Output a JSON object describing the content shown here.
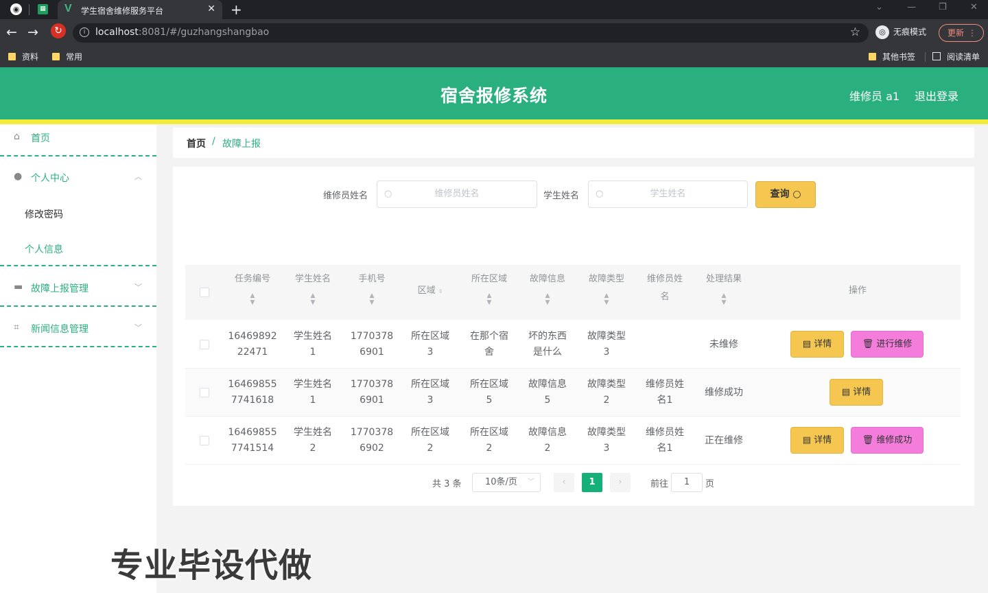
{
  "browser": {
    "tab_title": "学生宿舍维修服务平台",
    "url_host": "localhost",
    "url_rest": ":8081/#/guzhangshangbao",
    "incognito_label": "无痕模式",
    "update_label": "更新",
    "bookmarks": [
      "资料",
      "常用"
    ],
    "bookmarks_right": [
      "其他书签",
      "阅读清单"
    ]
  },
  "header": {
    "title": "宿舍报修系统",
    "user_label": "维修员 a1",
    "logout_label": "退出登录"
  },
  "sidebar": {
    "home": "首页",
    "personal_center": "个人中心",
    "change_password": "修改密码",
    "personal_info": "个人信息",
    "fault_report_mgmt": "故障上报管理",
    "news_mgmt": "新闻信息管理"
  },
  "breadcrumb": {
    "home": "首页",
    "separator": "/",
    "current": "故障上报"
  },
  "search": {
    "repairer_label": "维修员姓名",
    "repairer_placeholder": "维修员姓名",
    "student_label": "学生姓名",
    "student_placeholder": "学生姓名",
    "query_label": "查询"
  },
  "table": {
    "columns": [
      "任务编号",
      "学生姓名",
      "手机号",
      "区域",
      "所在区域",
      "故障信息",
      "故障类型",
      "维修员姓\n名",
      "处理结果",
      "操作"
    ],
    "rows": [
      {
        "task_no": "16469892\n22471",
        "student": "学生姓名\n1",
        "phone": "1770378\n6901",
        "region": "所在区域\n3",
        "location": "在那个宿\n舍",
        "fault_info": "坏的东西\n是什么",
        "fault_type": "故障类型\n3",
        "repairer": "",
        "result": "未维修",
        "detail_label": "详情",
        "action_label": "进行维修"
      },
      {
        "task_no": "16469855\n7741618",
        "student": "学生姓名\n1",
        "phone": "1770378\n6901",
        "region": "所在区域\n3",
        "location": "所在区域\n5",
        "fault_info": "故障信息\n5",
        "fault_type": "故障类型\n2",
        "repairer": "维修员姓\n名1",
        "result": "维修成功",
        "detail_label": "详情",
        "action_label": ""
      },
      {
        "task_no": "16469855\n7741514",
        "student": "学生姓名\n2",
        "phone": "1770378\n6902",
        "region": "所在区域\n2",
        "location": "所在区域\n2",
        "fault_info": "故障信息\n2",
        "fault_type": "故障类型\n3",
        "repairer": "维修员姓\n名1",
        "result": "正在维修",
        "detail_label": "详情",
        "action_label": "维修成功"
      }
    ]
  },
  "pagination": {
    "total": "共 3 条",
    "page_size": "10条/页",
    "current_page": "1",
    "goto_label": "前往",
    "goto_value": "1",
    "page_unit": "页"
  },
  "watermark": "专业毕设代做",
  "colors": {
    "brand_green": "#2ab07f",
    "accent_yellow": "#f2ec3c",
    "button_yellow": "#f5c750",
    "button_pink": "#f47ddc",
    "page_active": "#15b07a"
  }
}
